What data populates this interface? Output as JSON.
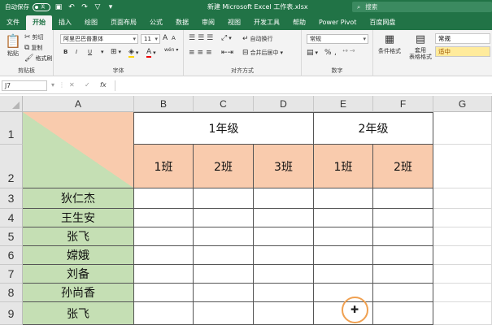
{
  "titlebar": {
    "autosave_label": "自动保存",
    "autosave_state": "关",
    "title": "新建 Microsoft Excel 工作表.xlsx",
    "search_placeholder": "搜索"
  },
  "tabs": [
    "文件",
    "开始",
    "插入",
    "绘图",
    "页面布局",
    "公式",
    "数据",
    "审阅",
    "视图",
    "开发工具",
    "帮助",
    "Power Pivot",
    "百度网盘"
  ],
  "active_tab": "开始",
  "ribbon": {
    "clipboard": {
      "label": "剪贴板",
      "paste": "粘贴",
      "cut": "剪切",
      "copy": "复制",
      "format_painter": "格式刷"
    },
    "font": {
      "label": "字体",
      "font_name": "阿里巴巴普惠体",
      "font_size": "11",
      "grow": "A",
      "shrink": "A",
      "bold": "B",
      "italic": "I",
      "underline": "U",
      "wen": "wén"
    },
    "alignment": {
      "label": "对齐方式",
      "wrap": "自动换行",
      "merge": "合并后居中"
    },
    "number": {
      "label": "数字",
      "format": "常规",
      "percent": "%",
      "comma": ","
    },
    "styles": {
      "conditional": "条件格式",
      "table": "套用\n表格格式",
      "normal": "常规",
      "neutral": "适中"
    }
  },
  "formula_bar": {
    "name_box": "J7",
    "cancel": "✕",
    "enter": "✓",
    "fx": "fx",
    "value": ""
  },
  "columns": [
    "A",
    "B",
    "C",
    "D",
    "E",
    "F",
    "G"
  ],
  "rows": [
    "1",
    "2",
    "3",
    "4",
    "5",
    "6",
    "7",
    "8",
    "9"
  ],
  "table": {
    "grade1": "1年级",
    "grade2": "2年级",
    "classes": [
      "1班",
      "2班",
      "3班",
      "1班",
      "2班"
    ],
    "names": [
      "狄仁杰",
      "王生安",
      "张飞",
      "嫦娥",
      "刘备",
      "孙尚香",
      "张飞"
    ]
  },
  "colors": {
    "excel_green": "#217346",
    "name_fill": "#c5dfb4",
    "header_fill": "#f9cbad"
  }
}
